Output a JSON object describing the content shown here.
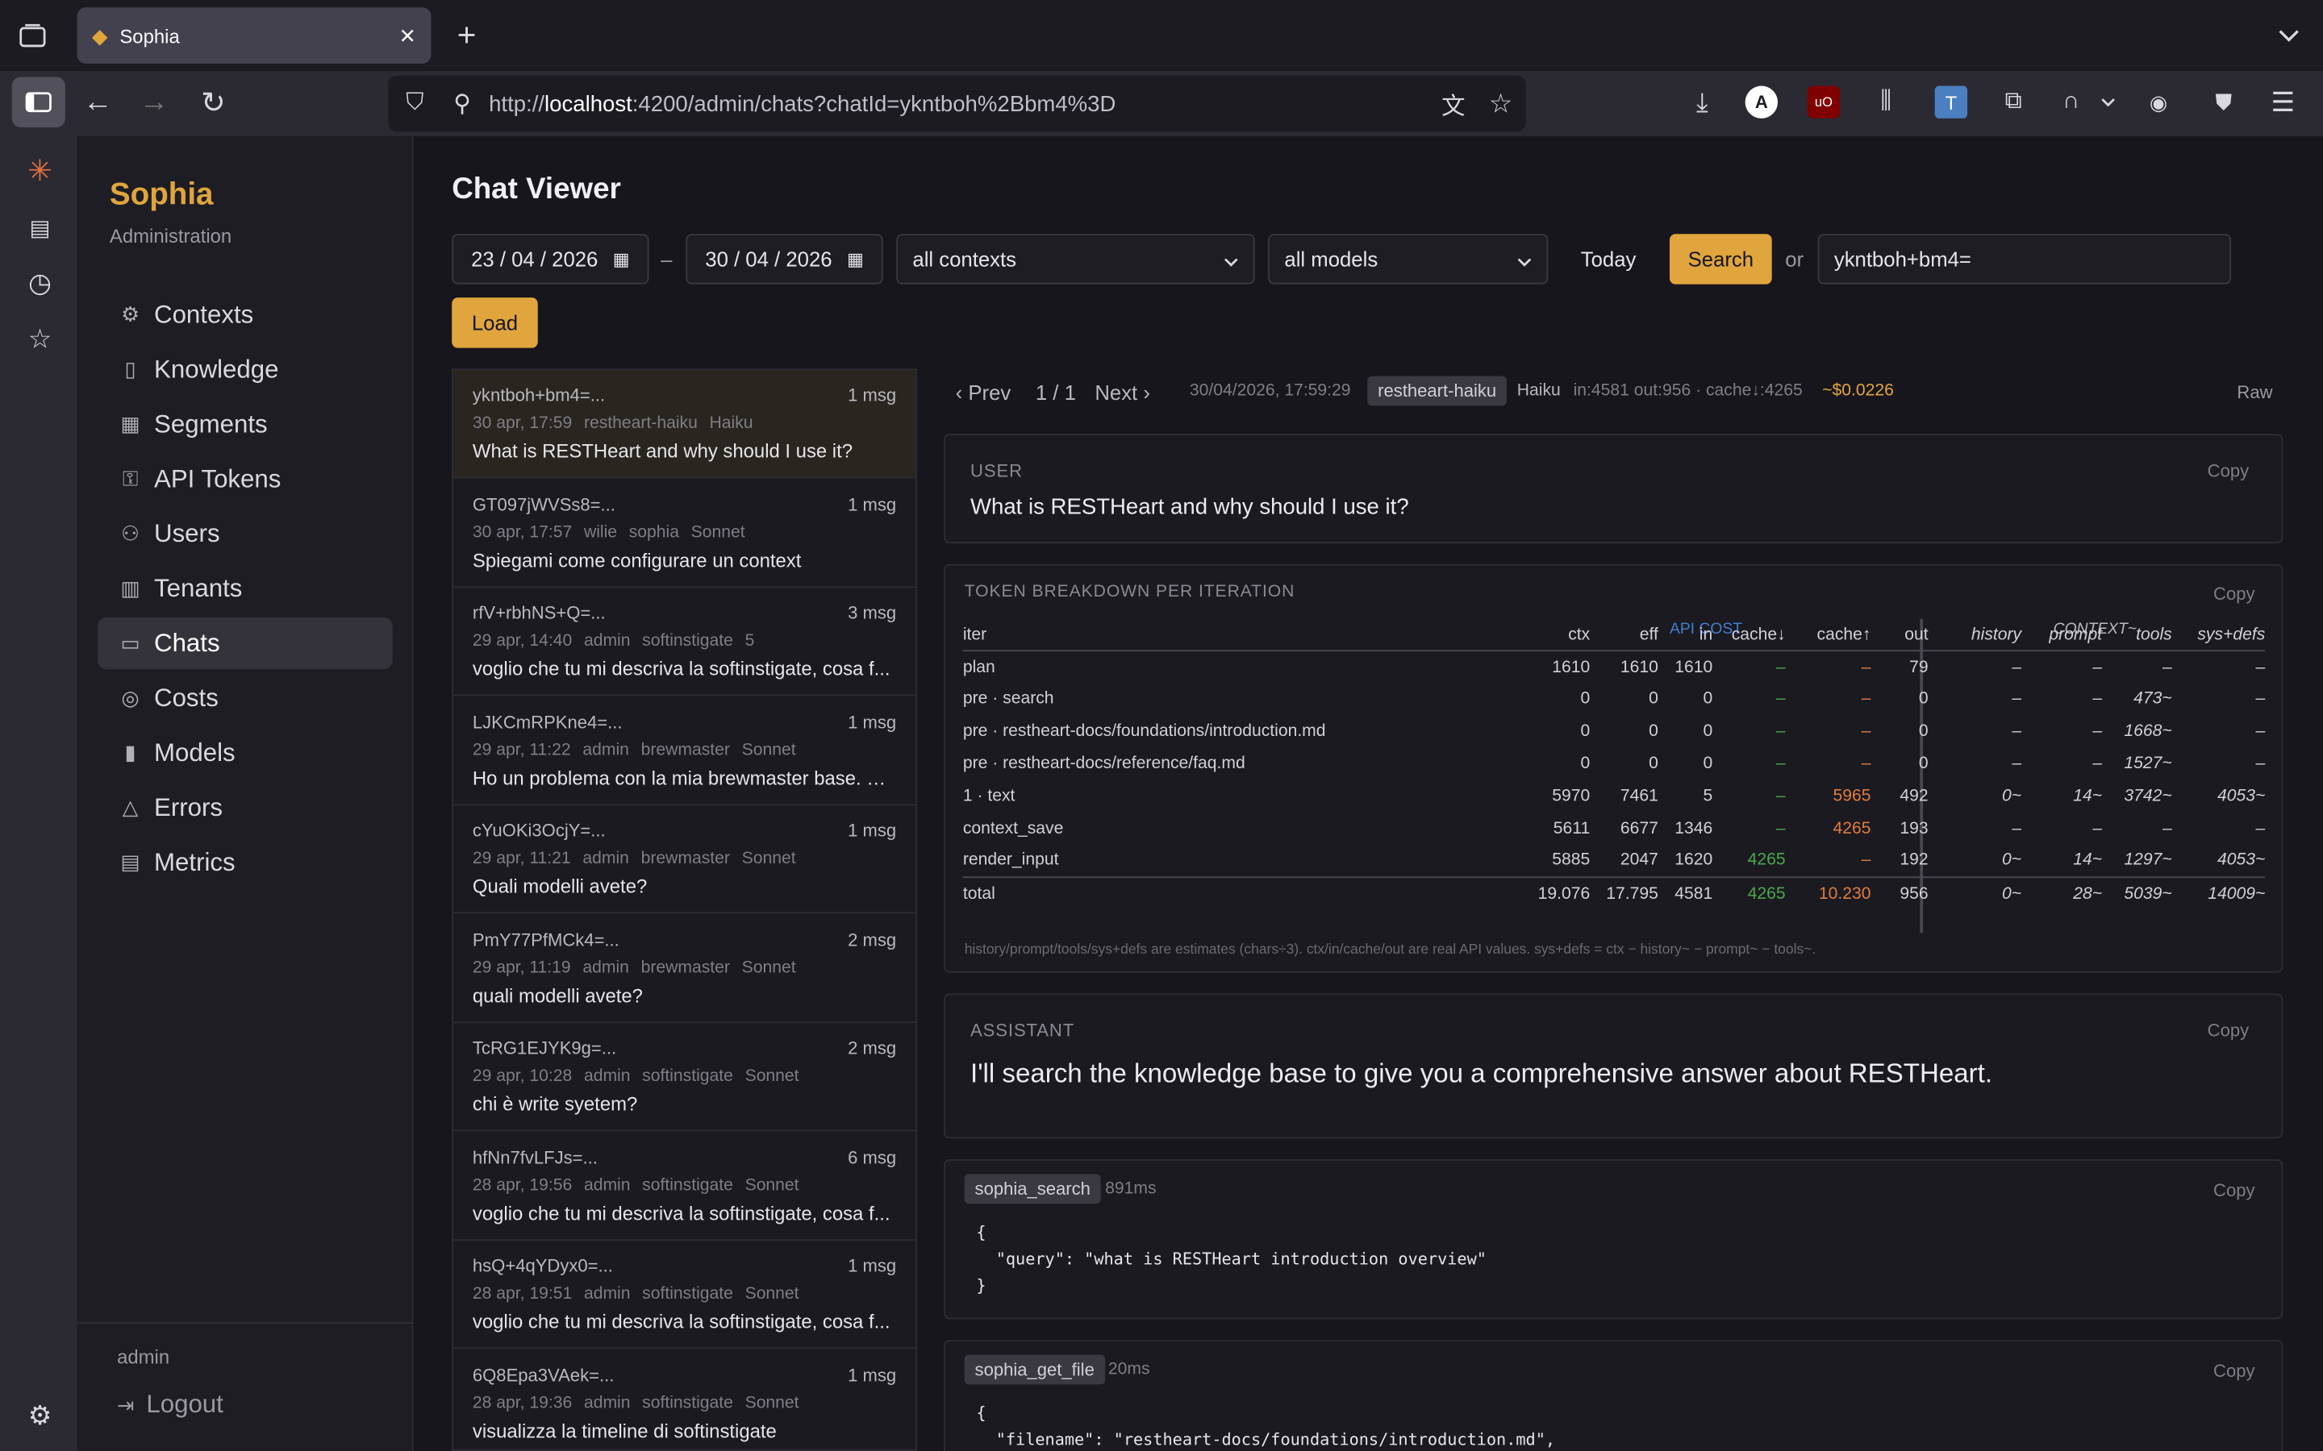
{
  "browser": {
    "tab_title": "Sophia",
    "url_prefix": "http://",
    "url_host": "localhost",
    "url_rest": ":4200/admin/chats?chatId=ykntboh%2Bbm4%3D"
  },
  "brand": {
    "name": "Sophia",
    "subtitle": "Administration"
  },
  "nav": [
    {
      "icon": "gear-icon",
      "label": "Contexts"
    },
    {
      "icon": "book-icon",
      "label": "Knowledge"
    },
    {
      "icon": "grid-icon",
      "label": "Segments"
    },
    {
      "icon": "key-icon",
      "label": "API Tokens"
    },
    {
      "icon": "users-icon",
      "label": "Users"
    },
    {
      "icon": "building-icon",
      "label": "Tenants"
    },
    {
      "icon": "chat-icon",
      "label": "Chats"
    },
    {
      "icon": "coins-icon",
      "label": "Costs"
    },
    {
      "icon": "bar-chart-icon",
      "label": "Models"
    },
    {
      "icon": "warning-icon",
      "label": "Errors"
    },
    {
      "icon": "metrics-icon",
      "label": "Metrics"
    }
  ],
  "footer": {
    "user": "admin",
    "logout": "Logout"
  },
  "page": {
    "title": "Chat Viewer",
    "date_from": "23 / 04 / 2026",
    "dash": "–",
    "date_to": "30 / 04 / 2026",
    "contexts": "all contexts",
    "models": "all models",
    "today": "Today",
    "search": "Search",
    "or": "or",
    "chat_id": "ykntboh+bm4=",
    "load": "Load"
  },
  "chats": [
    {
      "id": "ykntboh+bm4=...",
      "count": "1 msg",
      "date": "30 apr, 17:59",
      "user": "restheart-haiku",
      "ctx": "Haiku",
      "model": "",
      "msg": "What is RESTHeart and why should I use it?"
    },
    {
      "id": "GT097jWVSs8=...",
      "count": "1 msg",
      "date": "30 apr, 17:57",
      "user": "wilie",
      "ctx": "sophia",
      "model": "Sonnet",
      "msg": "Spiegami come configurare un context"
    },
    {
      "id": "rfV+rbhNS+Q=...",
      "count": "3 msg",
      "date": "29 apr, 14:40",
      "user": "admin",
      "ctx": "softinstigate",
      "model": "5",
      "msg": "voglio che tu mi descriva la softinstigate, cosa f..."
    },
    {
      "id": "LJKCmRPKne4=...",
      "count": "1 msg",
      "date": "29 apr, 11:22",
      "user": "admin",
      "ctx": "brewmaster",
      "model": "Sonnet",
      "msg": "Ho un problema con la mia brewmaster base. N..."
    },
    {
      "id": "cYuOKi3OcjY=...",
      "count": "1 msg",
      "date": "29 apr, 11:21",
      "user": "admin",
      "ctx": "brewmaster",
      "model": "Sonnet",
      "msg": "Quali modelli avete?"
    },
    {
      "id": "PmY77PfMCk4=...",
      "count": "2 msg",
      "date": "29 apr, 11:19",
      "user": "admin",
      "ctx": "brewmaster",
      "model": "Sonnet",
      "msg": "quali modelli avete?"
    },
    {
      "id": "TcRG1EJYK9g=...",
      "count": "2 msg",
      "date": "29 apr, 10:28",
      "user": "admin",
      "ctx": "softinstigate",
      "model": "Sonnet",
      "msg": "chi è write syetem?"
    },
    {
      "id": "hfNn7fvLFJs=...",
      "count": "6 msg",
      "date": "28 apr, 19:56",
      "user": "admin",
      "ctx": "softinstigate",
      "model": "Sonnet",
      "msg": "voglio che tu mi descriva la softinstigate, cosa f..."
    },
    {
      "id": "hsQ+4qYDyx0=...",
      "count": "1 msg",
      "date": "28 apr, 19:51",
      "user": "admin",
      "ctx": "softinstigate",
      "model": "Sonnet",
      "msg": "voglio che tu mi descriva la softinstigate, cosa f..."
    },
    {
      "id": "6Q8Epa3VAek=...",
      "count": "1 msg",
      "date": "28 apr, 19:36",
      "user": "admin",
      "ctx": "softinstigate",
      "model": "Sonnet",
      "msg": "visualizza la timeline di softinstigate"
    }
  ],
  "detail": {
    "prev": "‹ Prev",
    "pager": "1 / 1",
    "next": "Next ›",
    "timestamp": "30/04/2026, 17:59:29",
    "ctx_pill": "restheart-haiku",
    "model": "Haiku",
    "tokens": "in:4581 out:956 · cache↓:4265",
    "cost": "~$0.0226",
    "raw": "Raw",
    "copy": "Copy",
    "user_label": "USER",
    "user_msg": "What is RESTHeart and why should I use it?",
    "tb_label": "TOKEN BREAKDOWN PER ITERATION",
    "api_cost": "API COST",
    "context": "CONTEXT~",
    "cols": [
      "iter",
      "ctx",
      "eff",
      "in",
      "cache↓",
      "cache↑",
      "out",
      "history",
      "prompt",
      "tools",
      "sys+defs"
    ],
    "rows": [
      [
        "plan",
        "1610",
        "1610",
        "1610",
        "–",
        "–",
        "79",
        "–",
        "–",
        "–",
        "–"
      ],
      [
        "pre · search",
        "0",
        "0",
        "0",
        "–",
        "–",
        "0",
        "–",
        "–",
        "473~",
        "–"
      ],
      [
        "pre · restheart-docs/foundations/introduction.md",
        "0",
        "0",
        "0",
        "–",
        "–",
        "0",
        "–",
        "–",
        "1668~",
        "–"
      ],
      [
        "pre · restheart-docs/reference/faq.md",
        "0",
        "0",
        "0",
        "–",
        "–",
        "0",
        "–",
        "–",
        "1527~",
        "–"
      ],
      [
        "1 · text",
        "5970",
        "7461",
        "5",
        "–",
        "5965",
        "492",
        "0~",
        "14~",
        "3742~",
        "4053~"
      ],
      [
        "context_save",
        "5611",
        "6677",
        "1346",
        "–",
        "4265",
        "193",
        "–",
        "–",
        "–",
        "–"
      ],
      [
        "render_input",
        "5885",
        "2047",
        "1620",
        "4265",
        "–",
        "192",
        "0~",
        "14~",
        "1297~",
        "4053~"
      ],
      [
        "total",
        "19.076",
        "17.795",
        "4581",
        "4265",
        "10.230",
        "956",
        "0~",
        "28~",
        "5039~",
        "14009~"
      ]
    ],
    "tb_note": "history/prompt/tools/sys+defs are estimates (chars÷3). ctx/in/cache/out are real API values. sys+defs = ctx − history~ − prompt~ − tools~.",
    "assistant_label": "ASSISTANT",
    "assistant_msg": "I'll search the knowledge base to give you a comprehensive answer about RESTHeart.",
    "tool1": {
      "name": "sophia_search",
      "time": "891ms",
      "l1": "{",
      "l2": "  \"query\": \"what is RESTHeart introduction overview\"",
      "l3": "}"
    },
    "tool2": {
      "name": "sophia_get_file",
      "time": "20ms",
      "l1": "{",
      "l2": "  \"filename\": \"restheart-docs/foundations/introduction.md\","
    }
  },
  "colors": {
    "accent": "#e0a53d",
    "green": "#4aa84a",
    "orange": "#e07c3a"
  }
}
